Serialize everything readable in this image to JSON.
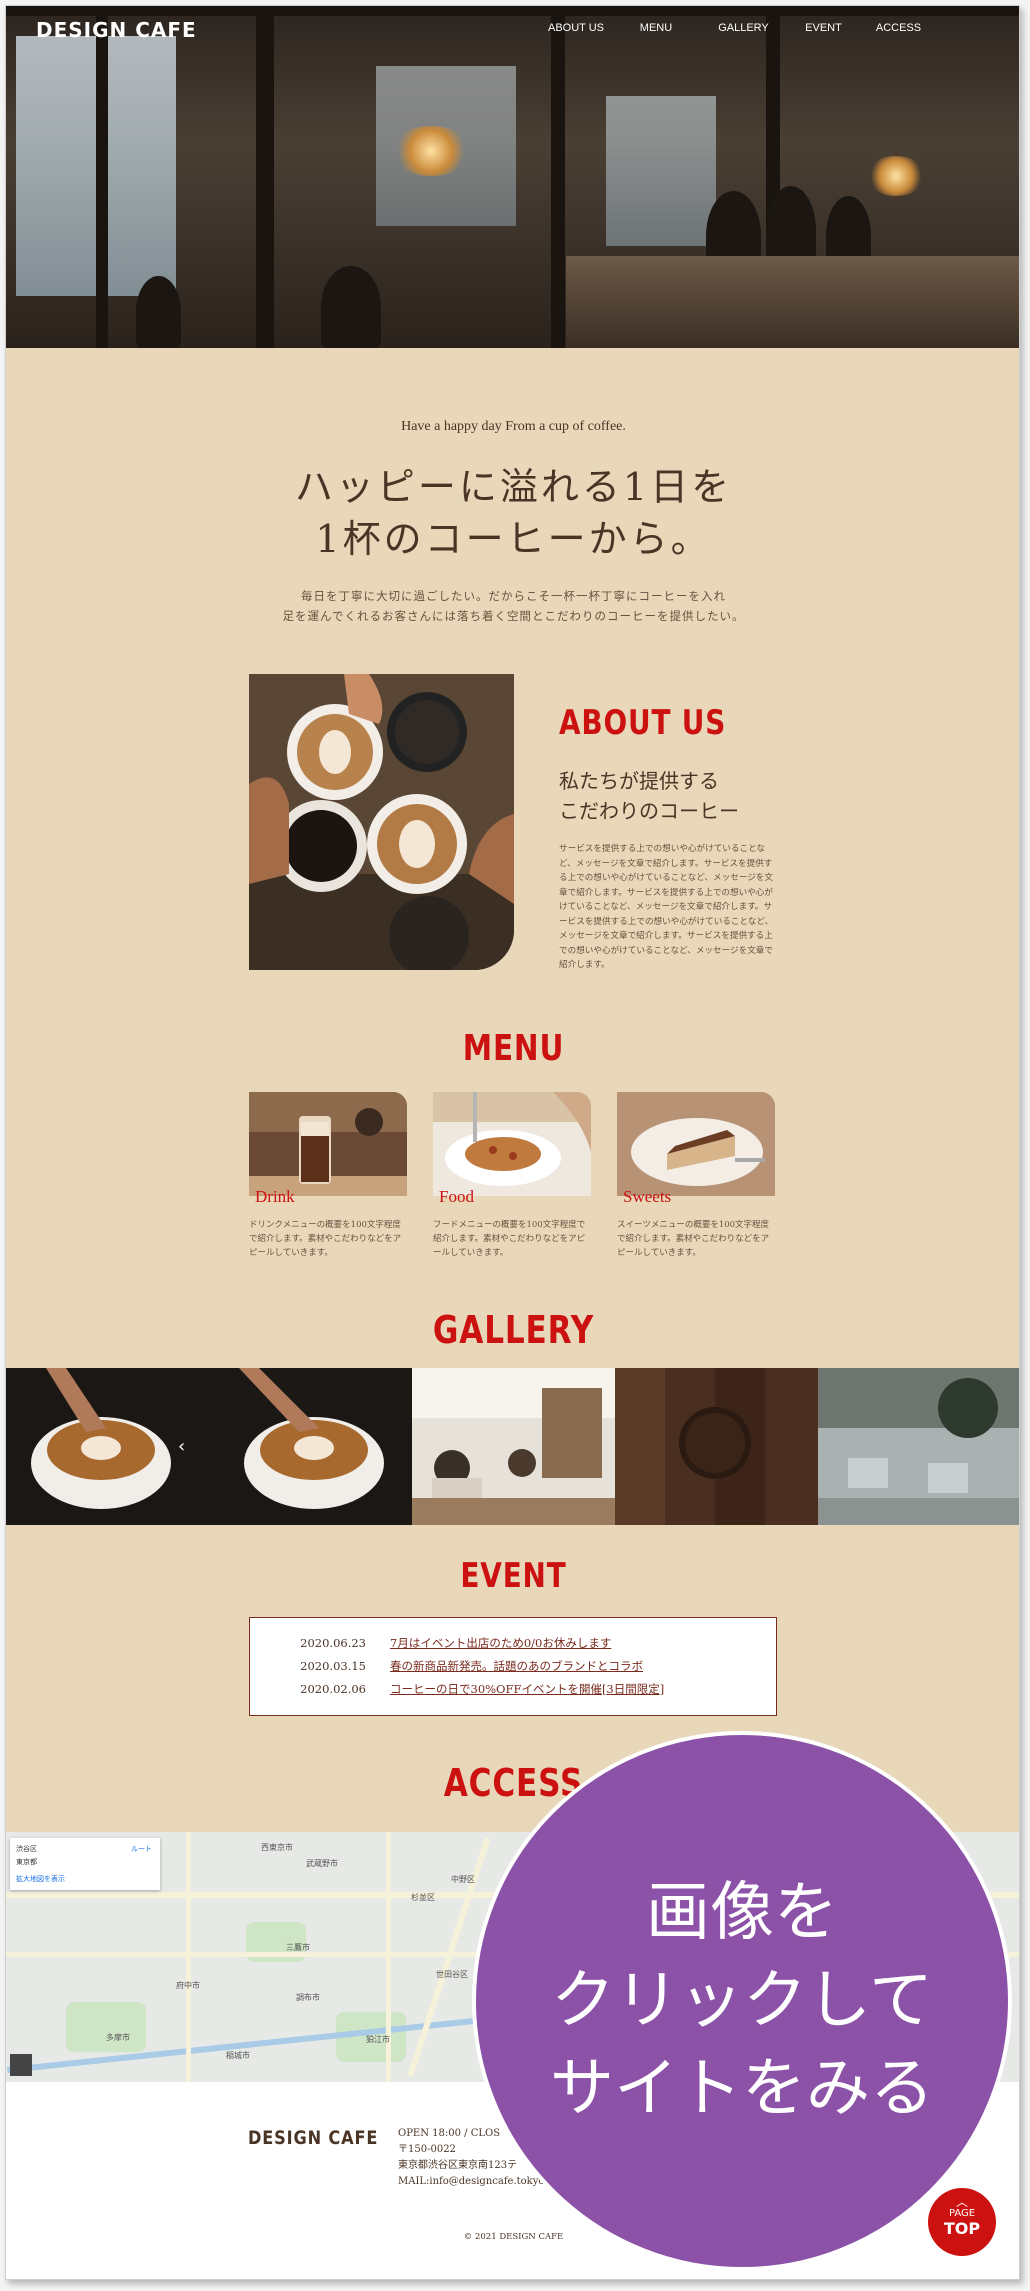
{
  "header": {
    "logo": "DESIGN CAFE",
    "nav": [
      "ABOUT US",
      "MENU",
      "GALLERY",
      "EVENT",
      "ACCESS"
    ]
  },
  "intro": {
    "tagline": "Have a happy day From a cup of coffee.",
    "headline_1": "ハッピーに溢れる1日を",
    "headline_2": "1杯のコーヒーから。",
    "lead_1": "毎日を丁寧に大切に過ごしたい。だからこそ一杯一杯丁寧にコーヒーを入れ",
    "lead_2": "足を運んでくれるお客さんには落ち着く空間とこだわりのコーヒーを提供したい。"
  },
  "about": {
    "title": "ABOUT US",
    "sub_1": "私たちが提供する",
    "sub_2": "こだわりのコーヒー",
    "body": "サービスを提供する上での想いや心がけていることなど、メッセージを文章で紹介します。サービスを提供する上での想いや心がけていることなど、メッセージを文章で紹介します。サービスを提供する上での想いや心がけていることなど、メッセージを文章で紹介します。サービスを提供する上での想いや心がけていることなど、メッセージを文章で紹介します。サービスを提供する上での想いや心がけていることなど、メッセージを文章で紹介します。"
  },
  "menu": {
    "title": "MENU",
    "items": [
      {
        "name": "Drink",
        "desc": "ドリンクメニューの概要を100文字程度で紹介します。素材やこだわりなどをアピールしていきます。"
      },
      {
        "name": "Food",
        "desc": "フードメニューの概要を100文字程度で紹介します。素材やこだわりなどをアピールしていきます。"
      },
      {
        "name": "Sweets",
        "desc": "スイーツメニューの概要を100文字程度で紹介します。素材やこだわりなどをアピールしていきます。"
      }
    ]
  },
  "gallery": {
    "title": "GALLERY",
    "prev_arrow": "‹"
  },
  "event": {
    "title": "EVENT",
    "items": [
      {
        "date": "2020.06.23",
        "text": "7月はイベント出店のため0/0お休みします"
      },
      {
        "date": "2020.03.15",
        "text": "春の新商品新発売。話題のあのブランドとコラボ"
      },
      {
        "date": "2020.02.06",
        "text": "コーヒーの日で30%OFFイベントを開催[3日間限定]"
      }
    ]
  },
  "access": {
    "title": "ACCESS",
    "map_info": {
      "place": "渋谷区",
      "sub": "東京都",
      "route": "ルート",
      "enlarge": "拡大地図を表示"
    },
    "map_labels": [
      "西東京市",
      "武蔵野市",
      "中野区",
      "杉並区",
      "三鷹市",
      "調布市",
      "府中市",
      "世田谷区",
      "狛江市",
      "多摩市",
      "稲城市"
    ]
  },
  "footer": {
    "logo": "DESIGN CAFE",
    "hours": "OPEN 18:00 / CLOS",
    "zip": "〒150-0022",
    "address": "東京都渋谷区東京南123テ",
    "mail": "MAIL:info@designcafe.tokyo",
    "copyright": "© 2021 DESIGN CAFE"
  },
  "overlay": {
    "line1": "画像を",
    "line2": "クリックして",
    "line3": "サイトをみる"
  },
  "pagetop": {
    "caret": "︿",
    "line1": "PAGE",
    "line2": "TOP"
  },
  "colors": {
    "accent": "#cc1111",
    "background": "#e8d7b9",
    "text": "#4a3426",
    "overlay": "#8b52a8"
  }
}
